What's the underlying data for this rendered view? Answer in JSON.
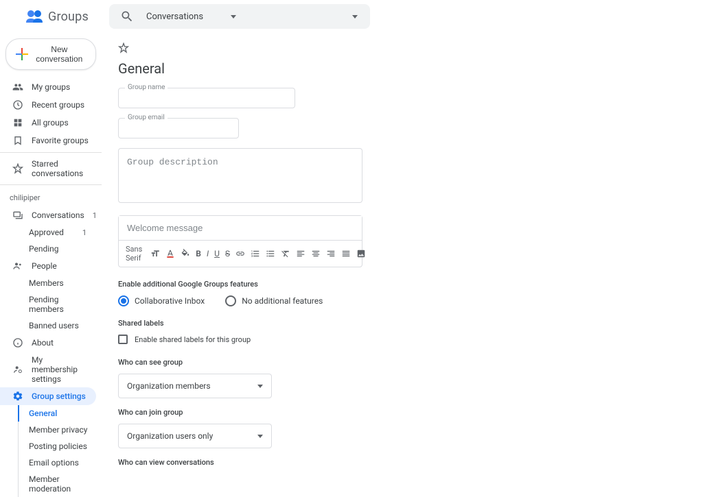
{
  "header": {
    "app_name": "Groups",
    "search_scope": "Conversations"
  },
  "sidebar": {
    "new_conversation": "New conversation",
    "top": [
      {
        "icon": "people",
        "label": "My groups"
      },
      {
        "icon": "clock",
        "label": "Recent groups"
      },
      {
        "icon": "grid",
        "label": "All groups"
      },
      {
        "icon": "bookmark",
        "label": "Favorite groups"
      }
    ],
    "starred": "Starred conversations",
    "workspace": "chilipiper",
    "conversations": {
      "label": "Conversations",
      "count": "1"
    },
    "conv_children": [
      {
        "label": "Approved",
        "count": "1"
      },
      {
        "label": "Pending"
      }
    ],
    "people": "People",
    "people_children": [
      {
        "label": "Members"
      },
      {
        "label": "Pending members"
      },
      {
        "label": "Banned users"
      }
    ],
    "about": "About",
    "membership_settings": "My membership settings",
    "group_settings": "Group settings",
    "settings_children": [
      {
        "label": "General",
        "selected": true
      },
      {
        "label": "Member privacy"
      },
      {
        "label": "Posting policies"
      },
      {
        "label": "Email options"
      },
      {
        "label": "Member moderation"
      }
    ]
  },
  "main": {
    "title": "General",
    "group_name_label": "Group name",
    "group_email_label": "Group email",
    "group_description_placeholder": "Group description",
    "welcome_placeholder": "Welcome message",
    "toolbar": {
      "font": "Sans Serif"
    },
    "features_heading": "Enable additional Google Groups features",
    "radio_collab": "Collaborative Inbox",
    "radio_none": "No additional features",
    "shared_labels_heading": "Shared labels",
    "shared_labels_checkbox": "Enable shared labels for this group",
    "who_see_heading": "Who can see group",
    "who_see_value": "Organization members",
    "who_join_heading": "Who can join group",
    "who_join_value": "Organization users only",
    "who_view_heading": "Who can view conversations"
  }
}
